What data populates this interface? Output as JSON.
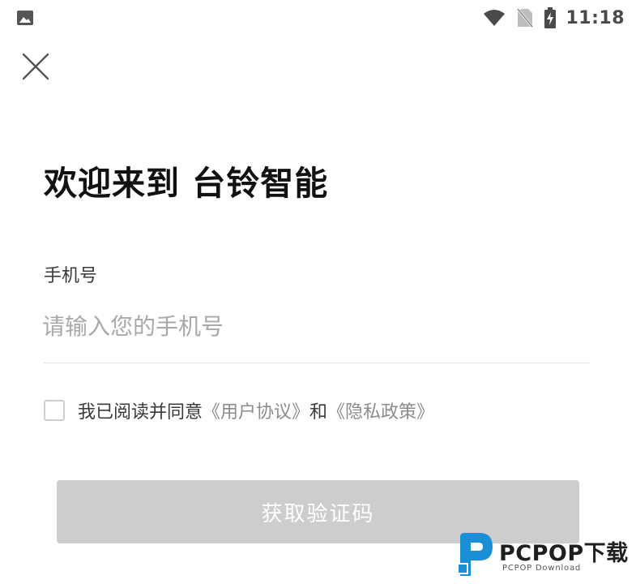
{
  "status_bar": {
    "time": "11:18",
    "icons": [
      "gallery-icon",
      "wifi-icon",
      "no-sim-icon",
      "battery-charging-icon"
    ]
  },
  "header": {
    "close_icon": "close-icon"
  },
  "main": {
    "title": "欢迎来到 台铃智能",
    "phone_label": "手机号",
    "phone_placeholder": "请输入您的手机号",
    "phone_value": "",
    "agreement": {
      "checked": false,
      "prefix": "我已阅读并同意",
      "user_agreement": "《用户协议》",
      "conjunction": "和",
      "privacy_policy": "《隐私政策》"
    },
    "get_code_label": "获取验证码"
  },
  "watermark": {
    "main": "PCPOP下载",
    "sub": "PCPOP Download"
  },
  "colors": {
    "button_disabled": "#cdcdcd",
    "link": "#8c8c8c",
    "watermark_blue": "#1a8fd6"
  }
}
